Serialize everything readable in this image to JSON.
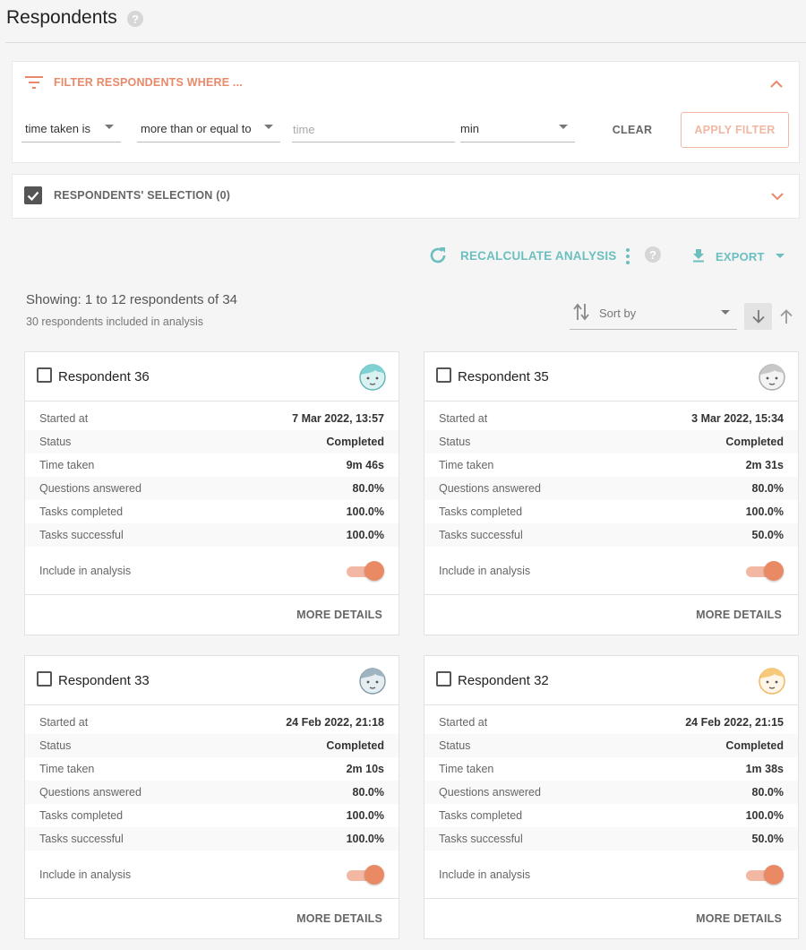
{
  "page": {
    "title": "Respondents"
  },
  "filter": {
    "title": "FILTER RESPONDENTS WHERE ...",
    "field": "time taken is",
    "operator": "more than or equal to",
    "value_placeholder": "time",
    "unit": "min",
    "clear_label": "CLEAR",
    "apply_label": "APPLY FILTER"
  },
  "selection": {
    "title": "RESPONDENTS' SELECTION (0)",
    "checked": true
  },
  "toolbar": {
    "recalculate_label": "RECALCULATE ANALYSIS",
    "export_label": "EXPORT"
  },
  "summary": {
    "showing": "Showing: 1 to 12 respondents of 34",
    "included": "30 respondents included in analysis"
  },
  "sort": {
    "label": "Sort by"
  },
  "labels": {
    "started_at": "Started at",
    "status": "Status",
    "time_taken": "Time taken",
    "questions_answered": "Questions answered",
    "tasks_completed": "Tasks completed",
    "tasks_successful": "Tasks successful",
    "include": "Include in analysis",
    "more_details": "MORE DETAILS"
  },
  "colors": {
    "accent": "#e8896a",
    "teal": "#6bbfbf"
  },
  "respondents": [
    {
      "name": "Respondent 36",
      "avatar": "boy-avatar-teal-icon",
      "started_at": "7 Mar 2022, 13:57",
      "status": "Completed",
      "time_taken": "9m 46s",
      "questions_answered": "80.0%",
      "tasks_completed": "100.0%",
      "tasks_successful": "100.0%",
      "included": true
    },
    {
      "name": "Respondent 35",
      "avatar": "boy-avatar-grey-icon",
      "started_at": "3 Mar 2022, 15:34",
      "status": "Completed",
      "time_taken": "2m 31s",
      "questions_answered": "80.0%",
      "tasks_completed": "100.0%",
      "tasks_successful": "50.0%",
      "included": true
    },
    {
      "name": "Respondent 33",
      "avatar": "boy-avatar-bluegrey-icon",
      "started_at": "24 Feb 2022, 21:18",
      "status": "Completed",
      "time_taken": "2m 10s",
      "questions_answered": "80.0%",
      "tasks_completed": "100.0%",
      "tasks_successful": "100.0%",
      "included": true
    },
    {
      "name": "Respondent 32",
      "avatar": "boy-avatar-orange-icon",
      "started_at": "24 Feb 2022, 21:15",
      "status": "Completed",
      "time_taken": "1m 38s",
      "questions_answered": "80.0%",
      "tasks_completed": "100.0%",
      "tasks_successful": "50.0%",
      "included": true
    }
  ]
}
